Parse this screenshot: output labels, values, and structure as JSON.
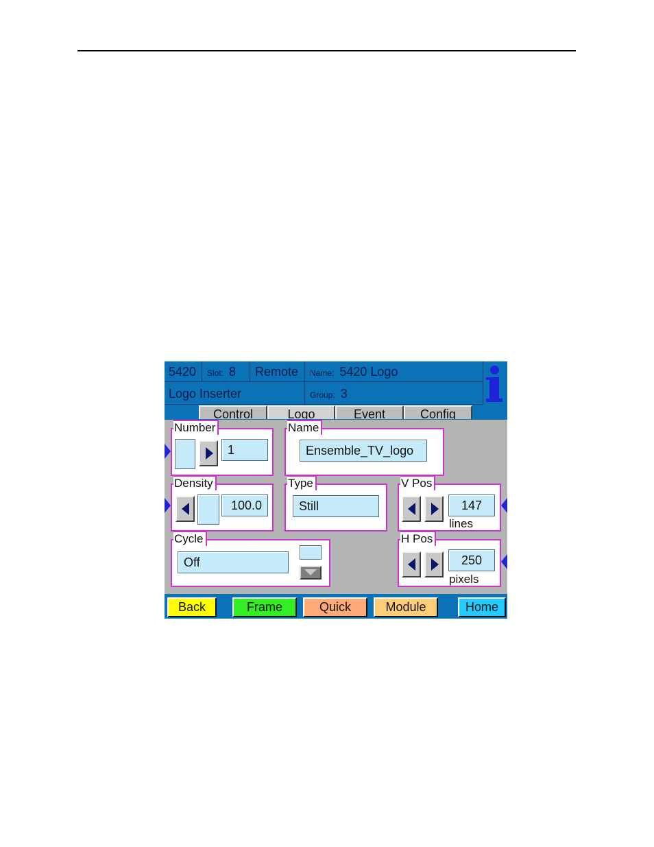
{
  "header": {
    "model": "5420",
    "slot_label": "Slot:",
    "slot_value": "8",
    "mode": "Remote",
    "name_label": "Name:",
    "name_value": "5420 Logo",
    "description": "Logo Inserter",
    "group_label": "Group:",
    "group_value": "3",
    "info_icon": "info-icon"
  },
  "tabs": [
    {
      "label": "Control",
      "active": false
    },
    {
      "label": "Logo",
      "active": true
    },
    {
      "label": "Event",
      "active": false
    },
    {
      "label": "Config",
      "active": false
    }
  ],
  "controls": {
    "number": {
      "label": "Number",
      "value": "1"
    },
    "name": {
      "label": "Name",
      "value": "Ensemble_TV_logo"
    },
    "density": {
      "label": "Density",
      "value": "100.0"
    },
    "type": {
      "label": "Type",
      "value": "Still"
    },
    "v_pos": {
      "label": "V Pos",
      "value": "147",
      "unit": "lines"
    },
    "cycle": {
      "label": "Cycle",
      "value": "Off"
    },
    "h_pos": {
      "label": "H Pos",
      "value": "250",
      "unit": "pixels"
    }
  },
  "nav": [
    {
      "label": "Back",
      "color": "#ffff00"
    },
    {
      "label": "Frame",
      "color": "#33ee22"
    },
    {
      "label": "Quick",
      "color": "#ffaa77"
    },
    {
      "label": "Module",
      "color": "#ffcc77"
    },
    {
      "label": "Home",
      "color": "#22ccff"
    }
  ],
  "colors": {
    "header_bg": "#0b72b8",
    "panel_bg": "#b4b4b4",
    "group_border": "#cc33cc",
    "field_bg": "#c5ebfb",
    "arrow": "#07166a"
  }
}
